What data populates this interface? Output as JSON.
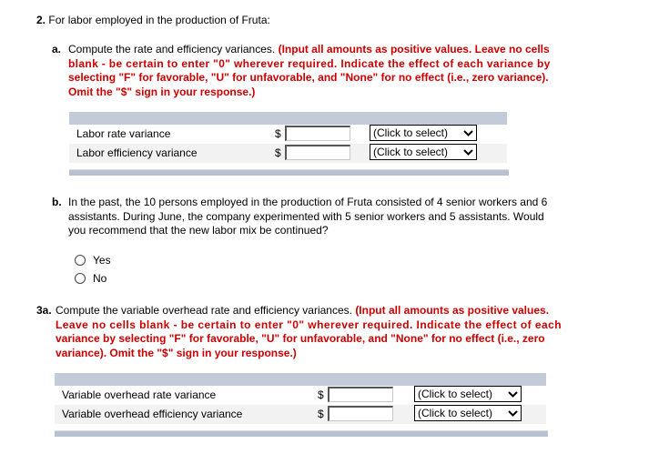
{
  "question2": {
    "number": "2.",
    "title": "For labor employed in the production of Fruta:",
    "part_a": {
      "letter": "a.",
      "prompt": "Compute the rate and efficiency variances.",
      "instructions_lines": [
        "(Input all amounts as positive values. Leave no cells",
        "blank - be certain to enter \"0\" wherever required. Indicate the effect of each variance by",
        "selecting \"F\" for favorable, \"U\" for unfavorable, and \"None\" for no effect (i.e., zero variance).",
        "Omit the \"$\" sign in your response.)"
      ],
      "table": {
        "rows": [
          {
            "label": "Labor rate variance",
            "currency": "$",
            "amount": "",
            "effect": "(Click to select)"
          },
          {
            "label": "Labor efficiency variance",
            "currency": "$",
            "amount": "",
            "effect": "(Click to select)"
          }
        ]
      }
    },
    "part_b": {
      "letter": "b.",
      "lines": [
        "In the past, the 10 persons employed in the production of Fruta consisted of 4 senior workers and 6",
        "assistants. During June, the company experimented with 5 senior workers and 5 assistants. Would",
        "you recommend that the new labor mix be continued?"
      ],
      "options": [
        "Yes",
        "No"
      ],
      "selected": null
    }
  },
  "question3a": {
    "number": "3a.",
    "prompt": "Compute the variable overhead rate and efficiency variances.",
    "instructions_lines": [
      "(Input all amounts as positive values.",
      "Leave no cells blank - be certain to enter \"0\" wherever required. Indicate the effect of each",
      "variance by selecting \"F\" for favorable, \"U\" for unfavorable, and \"None\" for no effect (i.e., zero",
      "variance). Omit the \"$\" sign in your response.)"
    ],
    "table": {
      "rows": [
        {
          "label": "Variable overhead rate variance",
          "currency": "$",
          "amount": "",
          "effect": "(Click to select)"
        },
        {
          "label": "Variable overhead efficiency variance",
          "currency": "$",
          "amount": "",
          "effect": "(Click to select)"
        }
      ]
    }
  },
  "colors": {
    "instruction_red": "#cc0000",
    "table_header": "#c3cad8",
    "row_alt": "#f2f2f2"
  }
}
